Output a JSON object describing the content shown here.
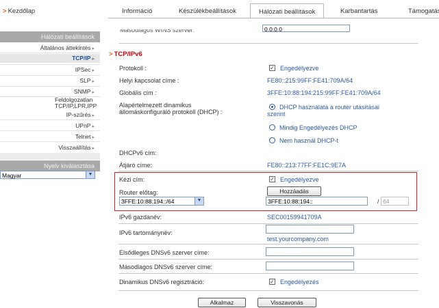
{
  "topnav": {
    "home": "Kezdőlap",
    "tabs": [
      "Információ",
      "Készülékbeállítások",
      "Hálózati beállítások",
      "Karbantartás",
      "Támogatás"
    ]
  },
  "sidebar": {
    "header": "Hálózati beállítások",
    "items": [
      {
        "label": "Általános áttekintés"
      },
      {
        "label": "TCP/IP"
      },
      {
        "label": "IPSec"
      },
      {
        "label": "SLP"
      },
      {
        "label": "SNMP"
      },
      {
        "label": "Feldolgozatlan TCP/IP,LPR,IPP"
      },
      {
        "label": "IP-szűrés"
      },
      {
        "label": "UPnP"
      },
      {
        "label": "Telnet"
      },
      {
        "label": "Visszaállítás"
      }
    ],
    "lang_header": "Nyelv kiválasztása",
    "lang_value": "Magyar"
  },
  "main": {
    "top_label": "Másodlagos WINS szerver:",
    "top_value": "0.0.0.0",
    "section_title": "TCP/IPv6",
    "protocol_label": "Protokoll :",
    "protocol_value": "Engedélyezve",
    "link_local_label": "Helyi kapcsolat címe :",
    "link_local_value": "FE80::215:99FF:FE41:709A/64",
    "global_label": "Globális cím :",
    "global_value": "3FFE:10:88:194:215:99FF:FE41:709A/64",
    "dhcp_label_1": "Alapértelmezett dinamikus",
    "dhcp_label_2": "állomáskonfiguráló protokoll (DHCP) :",
    "dhcp_option_1a": "DHCP használata a router utasításai",
    "dhcp_option_1b": "szerint",
    "dhcp_option_2": "Mindig Engedélyezés DHCP",
    "dhcp_option_3": "Nem használ DHCP-t",
    "dhcpv6_label": "DHCPv6 cím:",
    "gateway_label": "Átjáró címe:",
    "gateway_value": "FE80::213:77FF:FE1C:9E7A",
    "manual_label": "Kézi cím:",
    "manual_value": "Engedélyezve",
    "router_prefix_label": "Router előtag:",
    "router_prefix_select": "3FFE:10:88:194::/64",
    "add_button": "Hozzáadás",
    "prefix_input": "3FFE:10:88:194::",
    "prefix_slash": "/",
    "prefix_len": "64",
    "hostname_label": "IPv6 gazdanév:",
    "hostname_value": "SEC00159941709A",
    "domain_label": "IPv6 tartománynév:",
    "domain_value": "test.yourcompany.com",
    "dns1_label": "Elsődleges DNSv6 szerver címe:",
    "dns2_label": "Másodlagos DNSv6 szerver címe:",
    "ddns_label": "Dinamikus DNSv6 regisztráció:",
    "ddns_value": "Engedélyezés",
    "apply_button": "Alkalmaz",
    "cancel_button": "Visszavonás"
  }
}
